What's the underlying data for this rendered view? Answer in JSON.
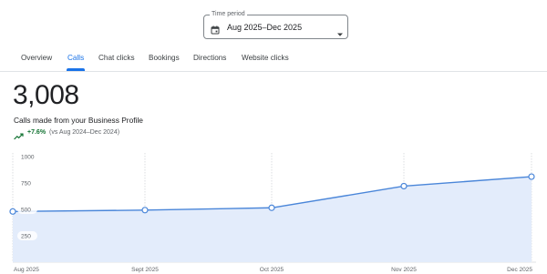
{
  "time_period": {
    "legend": "Time period",
    "value": "Aug 2025–Dec 2025",
    "icon": "calendar-icon"
  },
  "tabs": [
    {
      "label": "Overview",
      "active": false
    },
    {
      "label": "Calls",
      "active": true
    },
    {
      "label": "Chat clicks",
      "active": false
    },
    {
      "label": "Bookings",
      "active": false
    },
    {
      "label": "Directions",
      "active": false
    },
    {
      "label": "Website clicks",
      "active": false
    }
  ],
  "metric": {
    "value": "3,008",
    "description": "Calls made from your Business Profile",
    "change": "+7.6%",
    "comparison": "(vs Aug 2024–Dec 2024)",
    "trend_icon": "trending-up-icon"
  },
  "colors": {
    "accent": "#1a73e8",
    "positive": "#137333",
    "fill": "#e3ecfb",
    "line": "#4a86d9"
  },
  "chart_data": {
    "type": "area",
    "categories": [
      "Aug 2025",
      "Sept 2025",
      "Oct 2025",
      "Nov 2025",
      "Dec 2025"
    ],
    "values": [
      480,
      493,
      515,
      720,
      810
    ],
    "yticks": [
      "1000",
      "750",
      "500",
      "250"
    ],
    "ylim": [
      0,
      1000
    ],
    "grid": "vertical-dashed"
  }
}
